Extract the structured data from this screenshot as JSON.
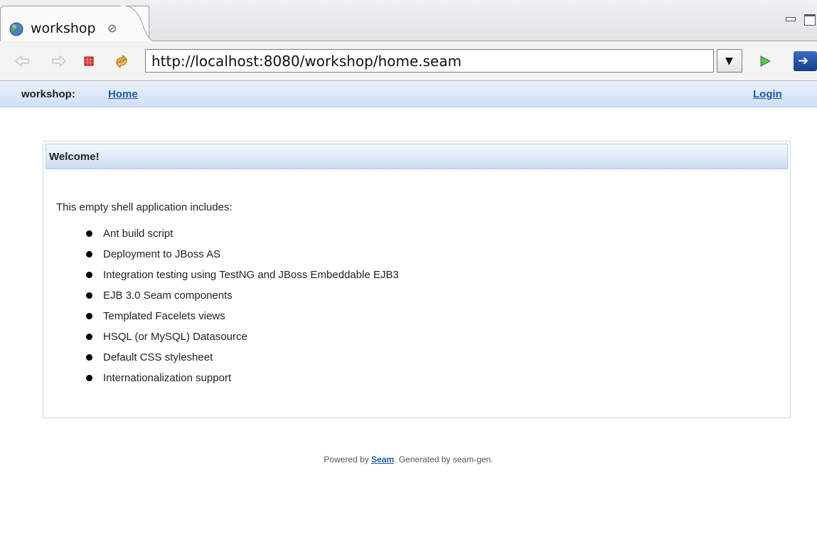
{
  "tab": {
    "title": "workshop",
    "close_glyph": "⊘"
  },
  "toolbar": {
    "url": "http://localhost:8080/workshop/home.seam",
    "icons": [
      "back-icon",
      "forward-icon",
      "stop-icon",
      "refresh-icon",
      "dropdown-icon",
      "go-icon",
      "open-external-icon"
    ]
  },
  "menu": {
    "app_label": "workshop:",
    "home_link": "Home",
    "login_link": "Login"
  },
  "panel": {
    "title": "Welcome!",
    "intro": "This empty shell application includes:",
    "features": [
      "Ant build script",
      "Deployment to JBoss AS",
      "Integration testing using TestNG and JBoss Embeddable EJB3",
      "EJB 3.0 Seam components",
      "Templated Facelets views",
      "HSQL (or MySQL) Datasource",
      "Default CSS stylesheet",
      "Internationalization support"
    ]
  },
  "footer": {
    "prefix": "Powered by ",
    "link": "Seam",
    "suffix": ". Generated by seam-gen."
  },
  "colors": {
    "link": "#1f5aa6",
    "menubar": "#cfe0f7",
    "panel_border": "#c9d8f0"
  }
}
